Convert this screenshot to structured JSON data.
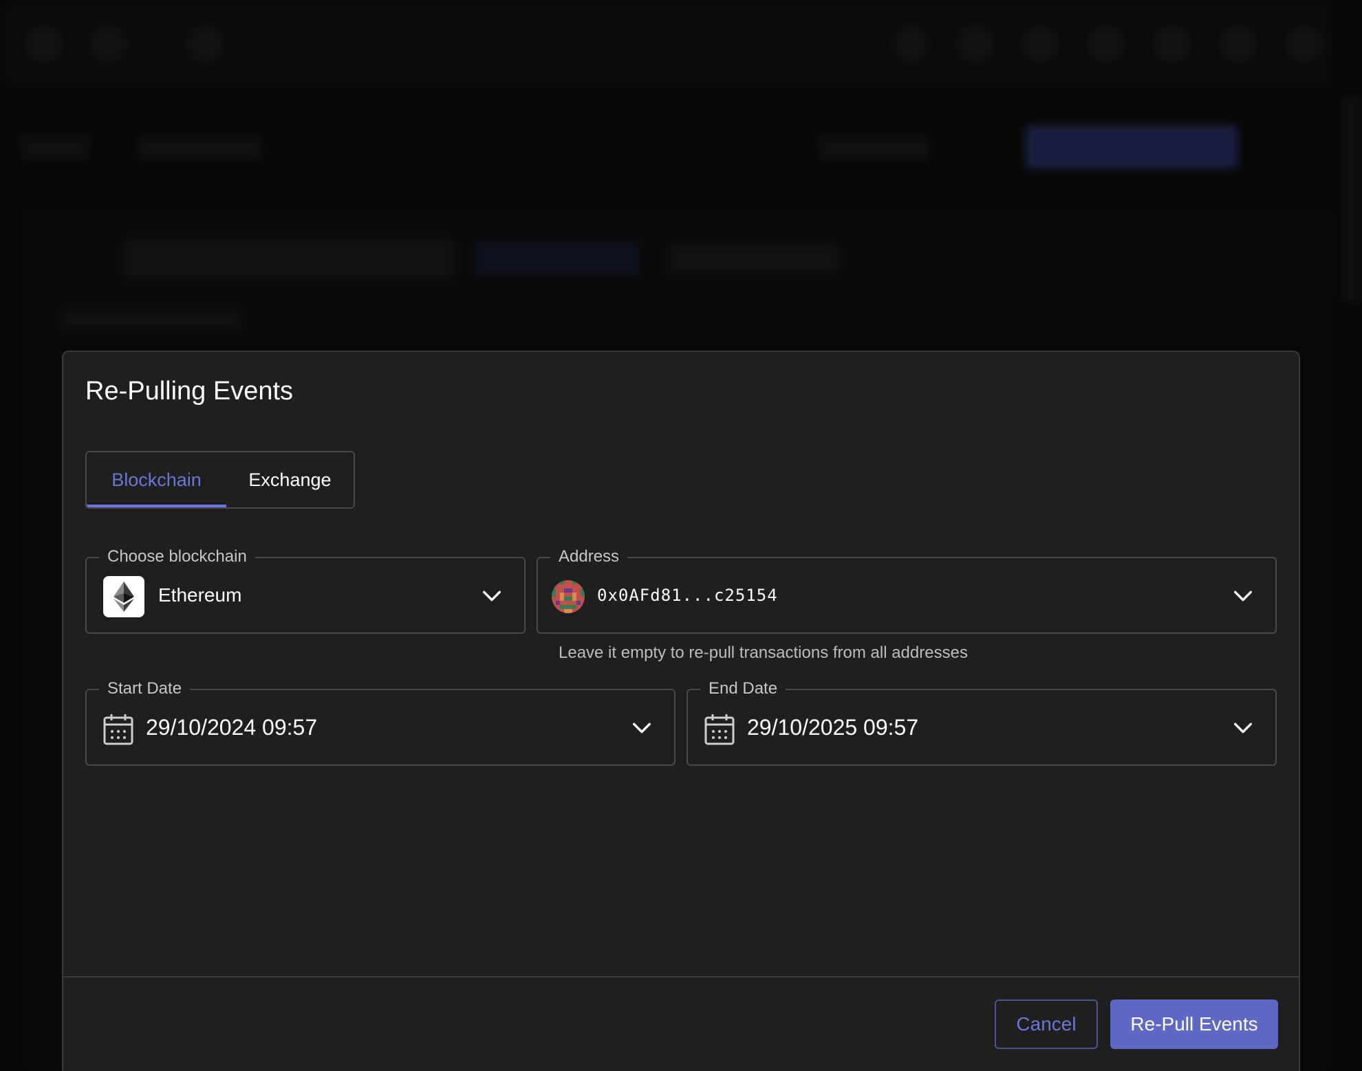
{
  "dialog": {
    "title": "Re-Pulling Events",
    "tabs": [
      {
        "label": "Blockchain",
        "active": true
      },
      {
        "label": "Exchange",
        "active": false
      }
    ],
    "blockchain_field": {
      "label": "Choose blockchain",
      "value": "Ethereum",
      "icon": "ethereum-icon"
    },
    "address_field": {
      "label": "Address",
      "value": "0x0AFd81...c25154",
      "helper": "Leave it empty to re-pull transactions from all addresses"
    },
    "start_date": {
      "label": "Start Date",
      "value": "29/10/2024 09:57"
    },
    "end_date": {
      "label": "End Date",
      "value": "29/10/2025 09:57"
    },
    "buttons": {
      "cancel": "Cancel",
      "submit": "Re-Pull Events"
    }
  },
  "colors": {
    "accent": "#6c78d8",
    "primary_button": "#5d69c4",
    "dialog_bg": "#1f1f1f",
    "border": "#4a4a4a"
  }
}
